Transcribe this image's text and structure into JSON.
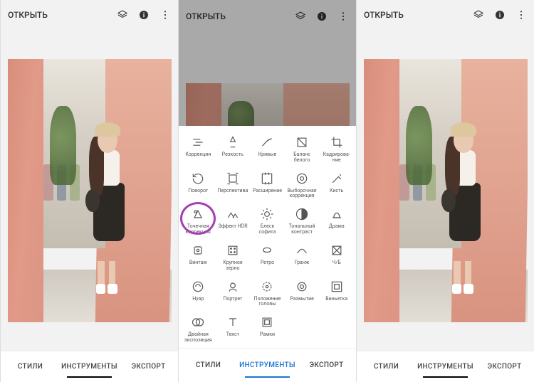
{
  "header": {
    "open_label": "ОТКРЫТЬ"
  },
  "tabs": {
    "styles": "СТИЛИ",
    "tools": "ИНСТРУМЕНТЫ",
    "export": "ЭКСПОРТ"
  },
  "tools": [
    {
      "label": "Коррекция"
    },
    {
      "label": "Резкость"
    },
    {
      "label": "Кривые"
    },
    {
      "label": "Баланс белого"
    },
    {
      "label": "Кадрирова­ние"
    },
    {
      "label": "Поворот"
    },
    {
      "label": "Перспектива"
    },
    {
      "label": "Расширение"
    },
    {
      "label": "Выборочная коррекция"
    },
    {
      "label": "Кисть"
    },
    {
      "label": "Точечная коррекция"
    },
    {
      "label": "Эффект HDR"
    },
    {
      "label": "Блеск софита"
    },
    {
      "label": "Тональный контраст"
    },
    {
      "label": "Драма"
    },
    {
      "label": "Винтаж"
    },
    {
      "label": "Крупное зерно"
    },
    {
      "label": "Ретро"
    },
    {
      "label": "Гранж"
    },
    {
      "label": "Ч/Б"
    },
    {
      "label": "Нуар"
    },
    {
      "label": "Портрет"
    },
    {
      "label": "Положение головы"
    },
    {
      "label": "Размытие"
    },
    {
      "label": "Виньетка"
    },
    {
      "label": "Двойная экспозиция"
    },
    {
      "label": "Текст"
    },
    {
      "label": "Рамки"
    }
  ],
  "highlighted_tool_index": 10
}
